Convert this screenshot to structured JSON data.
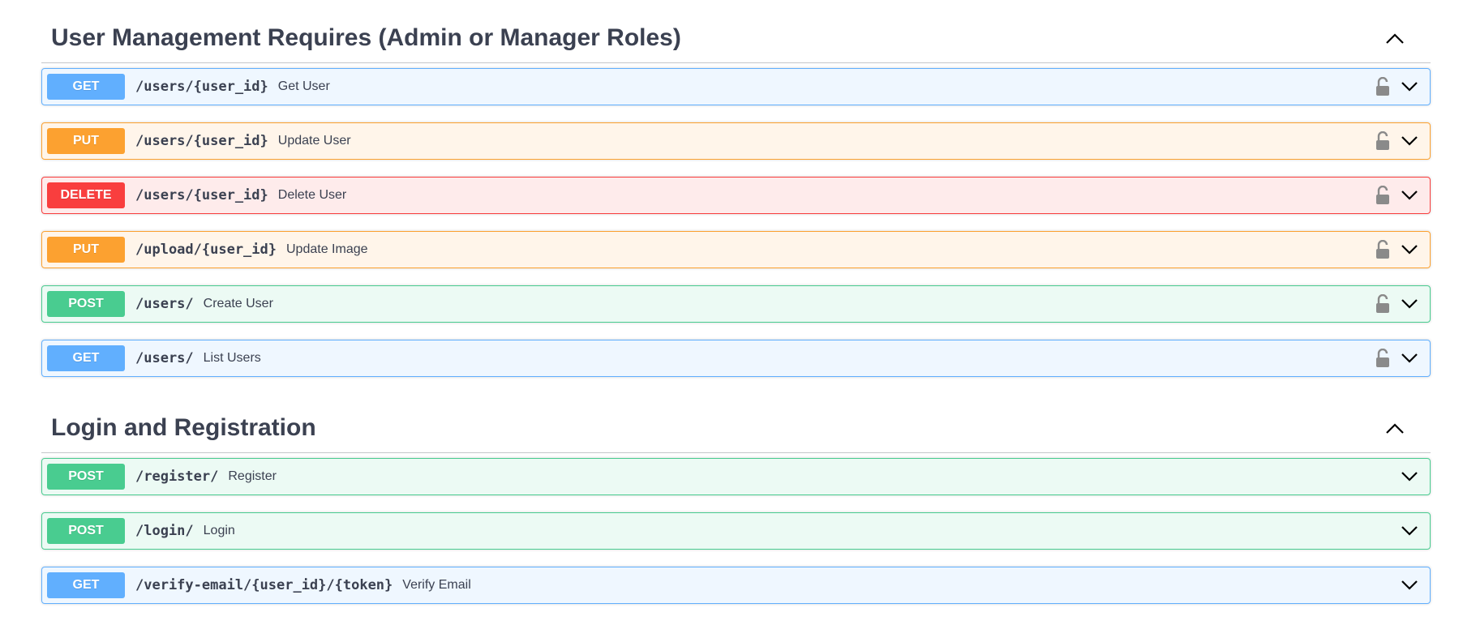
{
  "sections": [
    {
      "title": "User Management Requires (Admin or Manager Roles)",
      "toggle_icon": "chevron-up-icon",
      "operations": [
        {
          "method": "GET",
          "path": "/users/{user_id}",
          "summary": "Get User",
          "locked": true
        },
        {
          "method": "PUT",
          "path": "/users/{user_id}",
          "summary": "Update User",
          "locked": true
        },
        {
          "method": "DELETE",
          "path": "/users/{user_id}",
          "summary": "Delete User",
          "locked": true
        },
        {
          "method": "PUT",
          "path": "/upload/{user_id}",
          "summary": "Update Image",
          "locked": true
        },
        {
          "method": "POST",
          "path": "/users/",
          "summary": "Create User",
          "locked": true
        },
        {
          "method": "GET",
          "path": "/users/",
          "summary": "List Users",
          "locked": true
        }
      ]
    },
    {
      "title": "Login and Registration",
      "toggle_icon": "chevron-up-icon",
      "operations": [
        {
          "method": "POST",
          "path": "/register/",
          "summary": "Register",
          "locked": false
        },
        {
          "method": "POST",
          "path": "/login/",
          "summary": "Login",
          "locked": false
        },
        {
          "method": "GET",
          "path": "/verify-email/{user_id}/{token}",
          "summary": "Verify Email",
          "locked": false
        }
      ]
    }
  ],
  "colors": {
    "get": "#61affe",
    "put": "#fca130",
    "delete": "#f93e3e",
    "post": "#49cc90",
    "text": "#3b4151"
  }
}
